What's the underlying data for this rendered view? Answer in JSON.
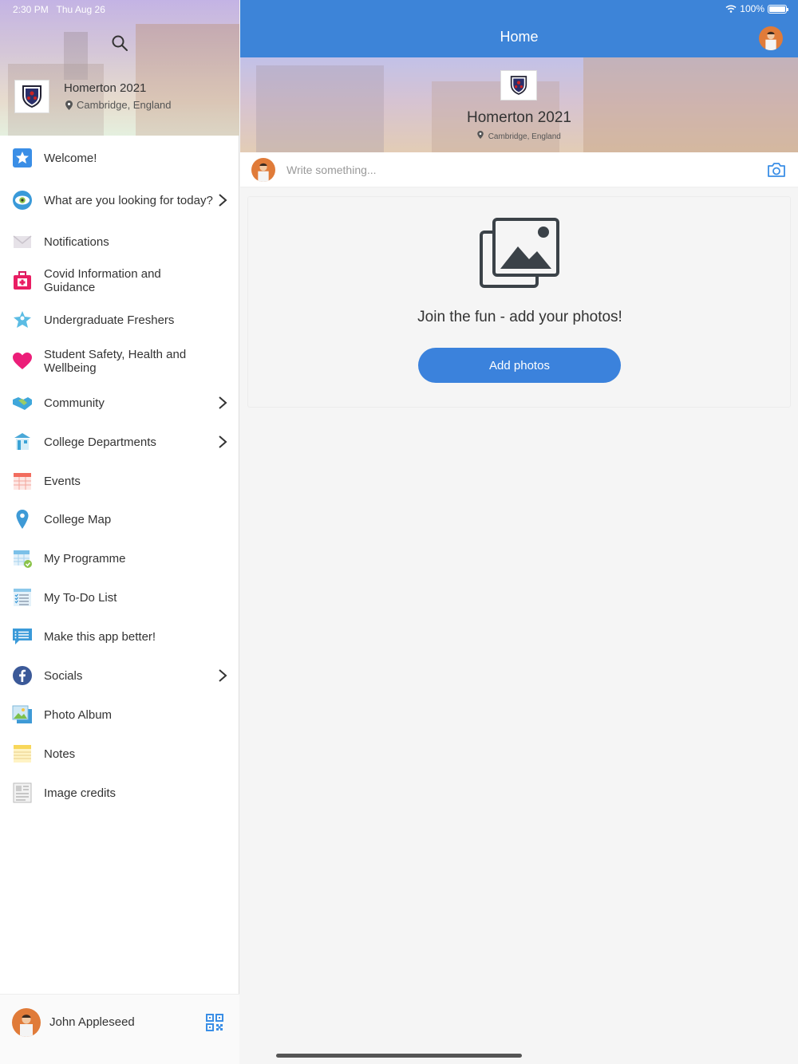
{
  "status_bar": {
    "time": "2:30 PM",
    "date": "Thu Aug 26",
    "battery": "100%",
    "battery_level": 1.0
  },
  "sidebar": {
    "org_name": "Homerton 2021",
    "org_location": "Cambridge, England",
    "items": [
      {
        "label": "Welcome!",
        "icon": "star-badge-icon",
        "has_submenu": false
      },
      {
        "label": "What are you looking for today?",
        "icon": "eye-icon",
        "has_submenu": true
      },
      {
        "label": "Notifications",
        "icon": "envelope-icon",
        "has_submenu": false
      },
      {
        "label": "Covid Information and Guidance",
        "icon": "first-aid-kit-icon",
        "has_submenu": false
      },
      {
        "label": "Undergraduate Freshers",
        "icon": "star-person-icon",
        "has_submenu": false
      },
      {
        "label": "Student Safety, Health and Wellbeing",
        "icon": "heart-icon",
        "has_submenu": false
      },
      {
        "label": "Community",
        "icon": "handshake-icon",
        "has_submenu": true
      },
      {
        "label": "College Departments",
        "icon": "department-icon",
        "has_submenu": true
      },
      {
        "label": "Events",
        "icon": "calendar-icon",
        "has_submenu": false
      },
      {
        "label": "College Map",
        "icon": "map-pin-icon",
        "has_submenu": false
      },
      {
        "label": "My Programme",
        "icon": "programme-calendar-icon",
        "has_submenu": false
      },
      {
        "label": "My To-Do List",
        "icon": "checklist-icon",
        "has_submenu": false
      },
      {
        "label": "Make this app better!",
        "icon": "feedback-chat-icon",
        "has_submenu": false
      },
      {
        "label": "Socials",
        "icon": "facebook-icon",
        "has_submenu": true
      },
      {
        "label": "Photo Album",
        "icon": "photo-album-icon",
        "has_submenu": false
      },
      {
        "label": "Notes",
        "icon": "notepad-icon",
        "has_submenu": false
      },
      {
        "label": "Image credits",
        "icon": "credits-document-icon",
        "has_submenu": false
      }
    ],
    "user_name": "John Appleseed"
  },
  "header": {
    "title": "Home"
  },
  "banner": {
    "title": "Homerton 2021",
    "location": "Cambridge, England"
  },
  "composer": {
    "placeholder": "Write something..."
  },
  "empty_state": {
    "message": "Join the fun - add your photos!",
    "button_label": "Add photos"
  },
  "colors": {
    "accent": "#3d84d8",
    "button": "#3b82dc"
  }
}
